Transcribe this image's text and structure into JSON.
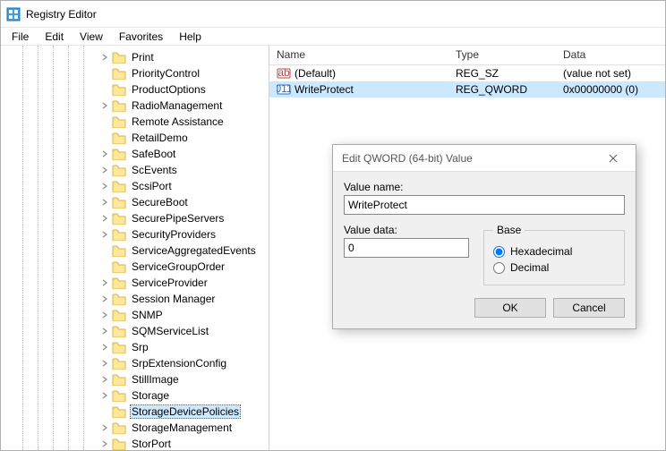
{
  "window": {
    "title": "Registry Editor"
  },
  "menu": {
    "file": "File",
    "edit": "Edit",
    "view": "View",
    "favorites": "Favorites",
    "help": "Help"
  },
  "tree": {
    "indent_base": 110,
    "items": [
      {
        "label": "Print",
        "exp": true,
        "selected": false
      },
      {
        "label": "PriorityControl",
        "exp": false,
        "selected": false
      },
      {
        "label": "ProductOptions",
        "exp": false,
        "selected": false
      },
      {
        "label": "RadioManagement",
        "exp": true,
        "selected": false
      },
      {
        "label": "Remote Assistance",
        "exp": false,
        "selected": false
      },
      {
        "label": "RetailDemo",
        "exp": false,
        "selected": false
      },
      {
        "label": "SafeBoot",
        "exp": true,
        "selected": false
      },
      {
        "label": "ScEvents",
        "exp": true,
        "selected": false
      },
      {
        "label": "ScsiPort",
        "exp": true,
        "selected": false
      },
      {
        "label": "SecureBoot",
        "exp": true,
        "selected": false
      },
      {
        "label": "SecurePipeServers",
        "exp": true,
        "selected": false
      },
      {
        "label": "SecurityProviders",
        "exp": true,
        "selected": false
      },
      {
        "label": "ServiceAggregatedEvents",
        "exp": false,
        "selected": false
      },
      {
        "label": "ServiceGroupOrder",
        "exp": false,
        "selected": false
      },
      {
        "label": "ServiceProvider",
        "exp": true,
        "selected": false
      },
      {
        "label": "Session Manager",
        "exp": true,
        "selected": false
      },
      {
        "label": "SNMP",
        "exp": true,
        "selected": false
      },
      {
        "label": "SQMServiceList",
        "exp": true,
        "selected": false
      },
      {
        "label": "Srp",
        "exp": true,
        "selected": false
      },
      {
        "label": "SrpExtensionConfig",
        "exp": true,
        "selected": false
      },
      {
        "label": "StillImage",
        "exp": true,
        "selected": false
      },
      {
        "label": "Storage",
        "exp": true,
        "selected": false
      },
      {
        "label": "StorageDevicePolicies",
        "exp": false,
        "selected": true
      },
      {
        "label": "StorageManagement",
        "exp": true,
        "selected": false
      },
      {
        "label": "StorPort",
        "exp": true,
        "selected": false
      }
    ]
  },
  "listHeader": {
    "name": "Name",
    "type": "Type",
    "data": "Data"
  },
  "listRows": [
    {
      "name": "(Default)",
      "type": "REG_SZ",
      "data": "(value not set)",
      "iconKind": "sz",
      "selected": false
    },
    {
      "name": "WriteProtect",
      "type": "REG_QWORD",
      "data": "0x00000000 (0)",
      "iconKind": "bin",
      "selected": true
    }
  ],
  "dialog": {
    "title": "Edit QWORD (64-bit) Value",
    "valueNameLabel": "Value name:",
    "valueName": "WriteProtect",
    "valueDataLabel": "Value data:",
    "valueData": "0",
    "baseLabel": "Base",
    "hex": "Hexadecimal",
    "dec": "Decimal",
    "ok": "OK",
    "cancel": "Cancel"
  }
}
